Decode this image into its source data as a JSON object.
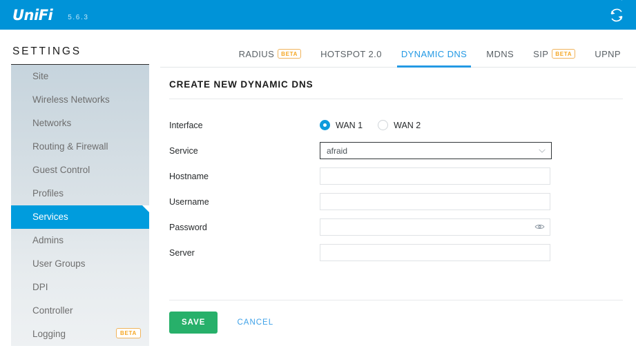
{
  "header": {
    "logo_text": "UniFi",
    "logo_icon": "wifi-arc-icon",
    "version": "5.6.3",
    "refresh_icon": "refresh-sync-icon",
    "bar_color": "#0093d8"
  },
  "sidebar": {
    "title": "SETTINGS",
    "items": [
      {
        "label": "Site",
        "active": false,
        "badge": null
      },
      {
        "label": "Wireless Networks",
        "active": false,
        "badge": null
      },
      {
        "label": "Networks",
        "active": false,
        "badge": null
      },
      {
        "label": "Routing & Firewall",
        "active": false,
        "badge": null
      },
      {
        "label": "Guest Control",
        "active": false,
        "badge": null
      },
      {
        "label": "Profiles",
        "active": false,
        "badge": null
      },
      {
        "label": "Services",
        "active": true,
        "badge": null
      },
      {
        "label": "Admins",
        "active": false,
        "badge": null
      },
      {
        "label": "User Groups",
        "active": false,
        "badge": null
      },
      {
        "label": "DPI",
        "active": false,
        "badge": null
      },
      {
        "label": "Controller",
        "active": false,
        "badge": null
      },
      {
        "label": "Logging",
        "active": false,
        "badge": "BETA"
      }
    ],
    "active_color": "#009cdd",
    "badge_color": "#f5a623"
  },
  "tabs": [
    {
      "label": "RADIUS",
      "badge": "BETA",
      "active": false
    },
    {
      "label": "HOTSPOT 2.0",
      "badge": null,
      "active": false
    },
    {
      "label": "DYNAMIC DNS",
      "badge": null,
      "active": true
    },
    {
      "label": "MDNS",
      "badge": null,
      "active": false
    },
    {
      "label": "SIP",
      "badge": "BETA",
      "active": false
    },
    {
      "label": "UPNP",
      "badge": null,
      "active": false
    }
  ],
  "panel": {
    "title": "CREATE NEW DYNAMIC DNS",
    "interface": {
      "label": "Interface",
      "options": [
        {
          "label": "WAN 1",
          "selected": true
        },
        {
          "label": "WAN 2",
          "selected": false
        }
      ]
    },
    "service": {
      "label": "Service",
      "value": "afraid",
      "chevron_icon": "chevron-down-icon"
    },
    "hostname": {
      "label": "Hostname",
      "value": "",
      "placeholder": ""
    },
    "username": {
      "label": "Username",
      "value": "",
      "placeholder": ""
    },
    "password": {
      "label": "Password",
      "value": "",
      "placeholder": "",
      "reveal_icon": "eye-icon"
    },
    "server": {
      "label": "Server",
      "value": "",
      "placeholder": ""
    },
    "save_label": "SAVE",
    "cancel_label": "CANCEL",
    "save_color": "#27b06a",
    "cancel_color": "#3ea1e8"
  }
}
